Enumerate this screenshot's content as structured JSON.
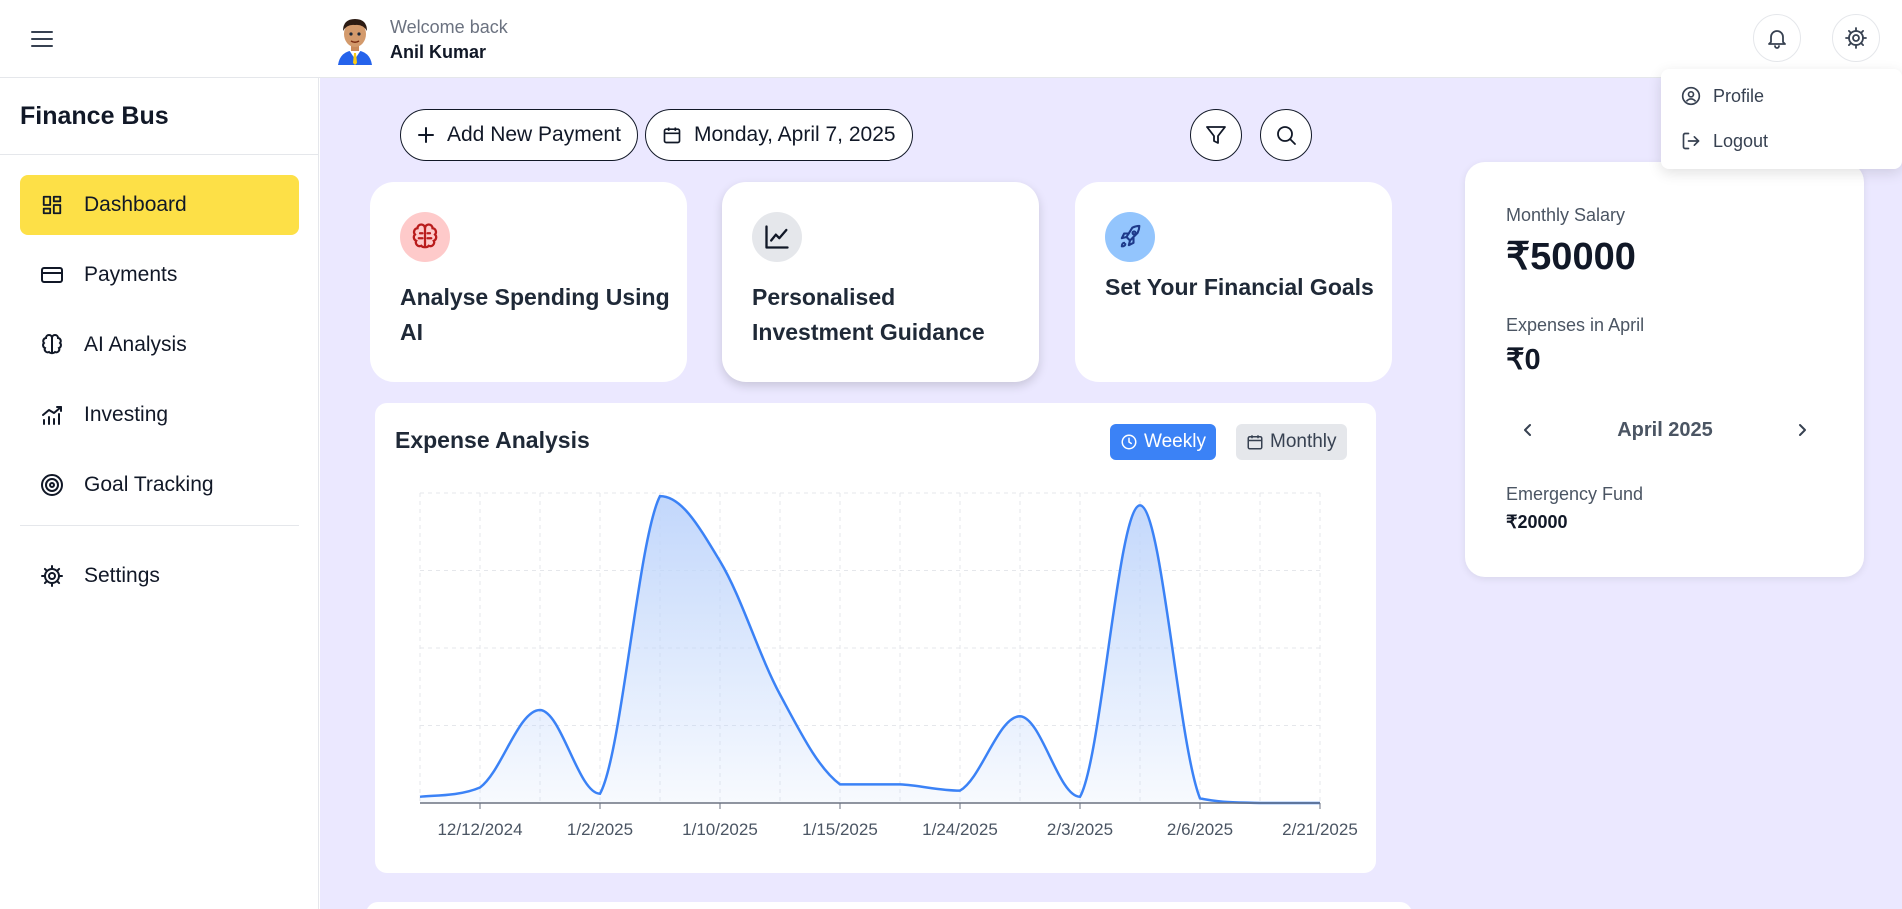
{
  "header": {
    "welcome_text": "Welcome back",
    "user_name": "Anil Kumar",
    "icons": {
      "menu": "hamburger-menu-icon",
      "notifications": "bell-icon",
      "settings": "gear-icon"
    }
  },
  "settings_menu": {
    "items": [
      {
        "label": "Profile",
        "icon": "user-circle-icon"
      },
      {
        "label": "Logout",
        "icon": "logout-icon"
      }
    ]
  },
  "sidebar": {
    "brand": "Finance Bus",
    "items": [
      {
        "label": "Dashboard",
        "icon": "dashboard-grid-icon",
        "active": true
      },
      {
        "label": "Payments",
        "icon": "credit-card-icon",
        "active": false
      },
      {
        "label": "AI Analysis",
        "icon": "brain-icon",
        "active": false
      },
      {
        "label": "Investing",
        "icon": "bar-chart-trend-icon",
        "active": false
      },
      {
        "label": "Goal Tracking",
        "icon": "target-icon",
        "active": false
      },
      {
        "label": "Settings",
        "icon": "gear-icon",
        "active": false
      }
    ]
  },
  "toolbar": {
    "add_payment_label": "Add New Payment",
    "date_label": "Monday, April 7, 2025",
    "icons": {
      "filter": "filter-icon",
      "search": "search-icon"
    }
  },
  "features": [
    {
      "title": "Analyse Spending Using AI",
      "icon": "brain-icon"
    },
    {
      "title": "Personalised Investment Guidance",
      "icon": "line-chart-icon"
    },
    {
      "title": "Set Your Financial Goals",
      "icon": "rocket-icon"
    }
  ],
  "expense_analysis": {
    "title": "Expense Analysis",
    "toggle_weekly": "Weekly",
    "toggle_monthly": "Monthly",
    "active_toggle": "Weekly"
  },
  "chart_data": {
    "type": "area",
    "title": "Expense Analysis",
    "x_tick_labels": [
      "12/12/2024",
      "1/2/2025",
      "1/10/2025",
      "1/15/2025",
      "1/24/2025",
      "2/3/2025",
      "2/6/2025",
      "2/21/2025"
    ],
    "x_index": [
      0,
      0.5,
      1,
      1.5,
      2,
      2.5,
      3,
      3.5,
      4,
      4.5,
      5,
      5.5,
      6,
      6.5,
      7,
      7.5
    ],
    "values": [
      2,
      5,
      30,
      3,
      99,
      78,
      35,
      6,
      6,
      4,
      28,
      2,
      96,
      1.5,
      0,
      0
    ],
    "ylim": [
      0,
      100
    ],
    "grid": true,
    "legend": "none",
    "line_color": "#3b82f6",
    "fill_color": "#bfd5fb"
  },
  "summary": {
    "salary_label": "Monthly Salary",
    "salary_value": "₹50000",
    "expenses_label": "Expenses in April",
    "expenses_value": "₹0",
    "month_label": "April 2025",
    "emergency_label": "Emergency Fund",
    "emergency_value": "₹20000"
  },
  "colors": {
    "accent_yellow": "#fde047",
    "main_bg": "#ebe8ff",
    "primary_blue": "#3b82f6"
  }
}
